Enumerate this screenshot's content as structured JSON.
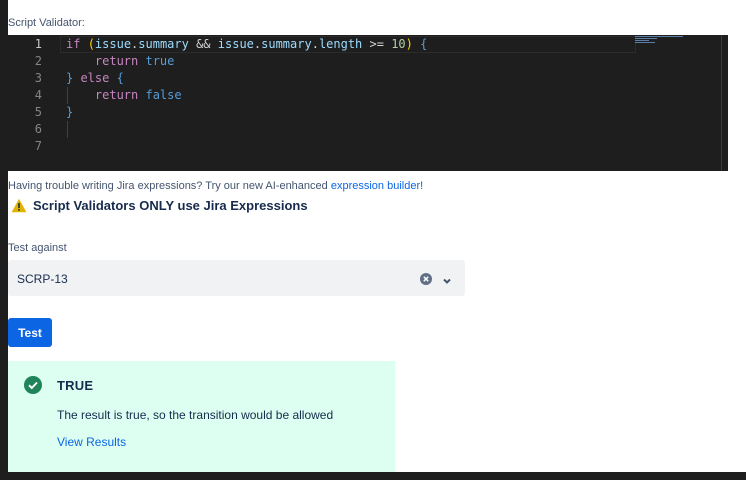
{
  "editor": {
    "label": "Script Validator:",
    "line_numbers": [
      "1",
      "2",
      "3",
      "4",
      "5",
      "6",
      "7"
    ],
    "lines": [
      {
        "tokens": [
          {
            "t": "if",
            "c": "kw"
          },
          {
            "t": " ",
            "c": "op"
          },
          {
            "t": "(",
            "c": "br"
          },
          {
            "t": "issue",
            "c": "id"
          },
          {
            "t": ".",
            "c": "op"
          },
          {
            "t": "summary",
            "c": "id"
          },
          {
            "t": " && ",
            "c": "op"
          },
          {
            "t": "issue",
            "c": "id"
          },
          {
            "t": ".",
            "c": "op"
          },
          {
            "t": "summary",
            "c": "id"
          },
          {
            "t": ".",
            "c": "op"
          },
          {
            "t": "length",
            "c": "id"
          },
          {
            "t": " >= ",
            "c": "op"
          },
          {
            "t": "10",
            "c": "num"
          },
          {
            "t": ")",
            "c": "br"
          },
          {
            "t": " {",
            "c": "kw2"
          }
        ]
      },
      {
        "tokens": [
          {
            "t": "    return ",
            "c": "kw"
          },
          {
            "t": "true",
            "c": "kw2"
          }
        ]
      },
      {
        "tokens": [
          {
            "t": "}",
            "c": "kw2"
          },
          {
            "t": " else ",
            "c": "kw"
          },
          {
            "t": "{",
            "c": "kw2"
          }
        ]
      },
      {
        "tokens": [
          {
            "t": "    return ",
            "c": "kw"
          },
          {
            "t": "false",
            "c": "kw2"
          }
        ]
      },
      {
        "tokens": [
          {
            "t": "}",
            "c": "kw2"
          }
        ]
      },
      {
        "tokens": []
      },
      {
        "tokens": []
      }
    ]
  },
  "help": {
    "text": "Having trouble writing Jira expressions? Try our new AI-enhanced ",
    "link": "expression builder",
    "suffix": "!"
  },
  "warning": {
    "icon": "warning-icon",
    "text": "Script Validators ONLY use Jira Expressions"
  },
  "test": {
    "label": "Test against",
    "value": "SCRP-13",
    "button": "Test"
  },
  "result": {
    "icon": "check-circle-icon",
    "title": "TRUE",
    "message": "The result is true, so the transition would be allowed",
    "link": "View Results"
  },
  "colors": {
    "accent": "#0c66e4",
    "success_bg": "#dcfff1",
    "success_icon": "#1f845a",
    "warning": "#e2b203",
    "editor_bg": "#1e1e1e"
  }
}
